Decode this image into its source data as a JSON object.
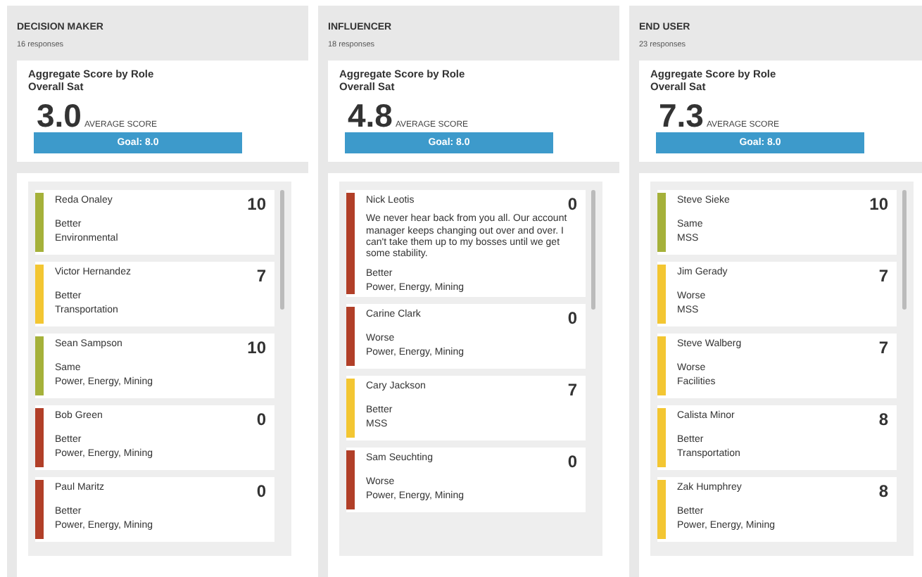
{
  "columns": [
    {
      "role": "DECISION MAKER",
      "responses": "16 responses",
      "card_title": "Aggregate Score by Role",
      "card_subtitle": "Overall Sat",
      "average": "3.0",
      "average_label": "AVERAGE SCORE",
      "goal": "Goal: 8.0",
      "responses_list": [
        {
          "name": "Reda Onaley",
          "score": "10",
          "trend": "Better",
          "industry": "Environmental",
          "color": "#a5b13a"
        },
        {
          "name": "Victor Hernandez",
          "score": "7",
          "trend": "Better",
          "industry": "Transportation",
          "color": "#f3c632"
        },
        {
          "name": "Sean Sampson",
          "score": "10",
          "trend": "Same",
          "industry": "Power, Energy, Mining",
          "color": "#a5b13a"
        },
        {
          "name": "Bob Green",
          "score": "0",
          "trend": "Better",
          "industry": "Power, Energy, Mining",
          "color": "#b13f28"
        },
        {
          "name": "Paul Maritz",
          "score": "0",
          "trend": "Better",
          "industry": "Power, Energy, Mining",
          "color": "#b13f28"
        }
      ]
    },
    {
      "role": "INFLUENCER",
      "responses": "18 responses",
      "card_title": "Aggregate Score by Role",
      "card_subtitle": "Overall Sat",
      "average": "4.8",
      "average_label": "AVERAGE SCORE",
      "goal": "Goal: 8.0",
      "responses_list": [
        {
          "name": "Nick Leotis",
          "score": "0",
          "comment": "We never hear back from you all. Our account manager keeps changing out over and over. I can't take them up to my bosses until we get some stability.",
          "trend": "Better",
          "industry": "Power, Energy, Mining",
          "color": "#b13f28"
        },
        {
          "name": "Carine Clark",
          "score": "0",
          "trend": "Worse",
          "industry": "Power, Energy, Mining",
          "color": "#b13f28"
        },
        {
          "name": "Cary Jackson",
          "score": "7",
          "trend": "Better",
          "industry": "MSS",
          "color": "#f3c632"
        },
        {
          "name": "Sam Seuchting",
          "score": "0",
          "trend": "Worse",
          "industry": "Power, Energy, Mining",
          "color": "#b13f28"
        }
      ]
    },
    {
      "role": "END USER",
      "responses": "23 responses",
      "card_title": "Aggregate Score by Role",
      "card_subtitle": "Overall Sat",
      "average": "7.3",
      "average_label": "AVERAGE SCORE",
      "goal": "Goal: 8.0",
      "responses_list": [
        {
          "name": "Steve Sieke",
          "score": "10",
          "trend": "Same",
          "industry": "MSS",
          "color": "#a5b13a"
        },
        {
          "name": "Jim Gerady",
          "score": "7",
          "trend": "Worse",
          "industry": "MSS",
          "color": "#f3c632"
        },
        {
          "name": "Steve Walberg",
          "score": "7",
          "trend": "Worse",
          "industry": "Facilities",
          "color": "#f3c632"
        },
        {
          "name": "Calista Minor",
          "score": "8",
          "trend": "Better",
          "industry": "Transportation",
          "color": "#f3c632"
        },
        {
          "name": "Zak Humphrey",
          "score": "8",
          "trend": "Better",
          "industry": "Power, Energy, Mining",
          "color": "#f3c632"
        }
      ]
    }
  ]
}
